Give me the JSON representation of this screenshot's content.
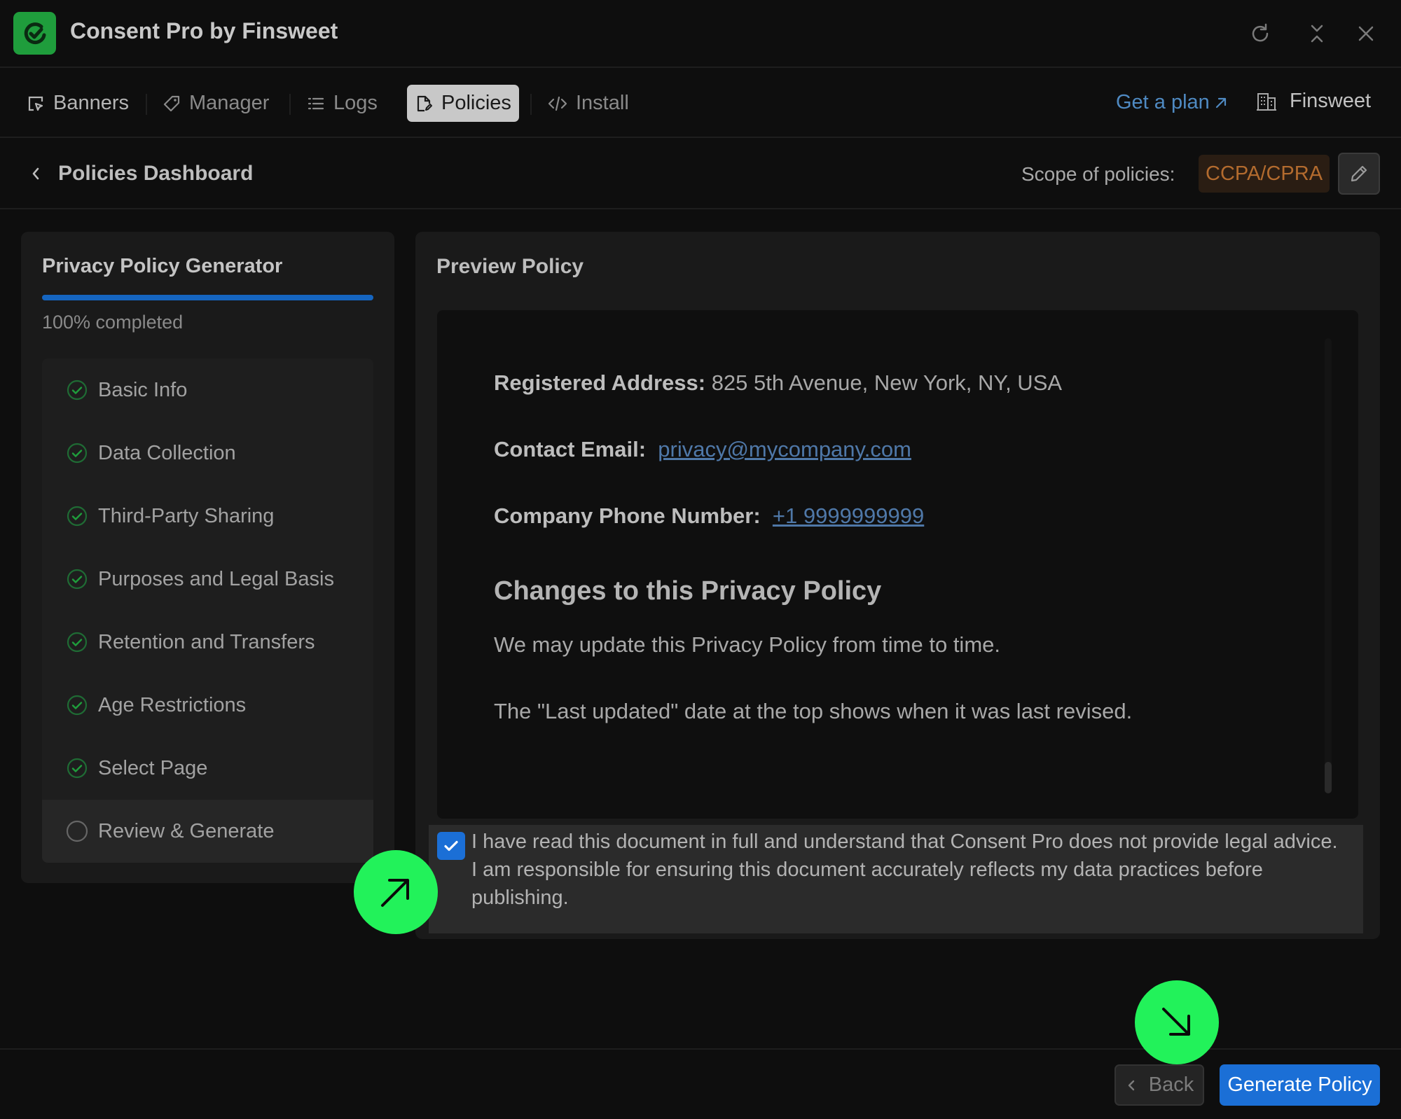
{
  "window": {
    "title": "Consent Pro by Finsweet"
  },
  "nav": {
    "items": [
      {
        "label": "Banners"
      },
      {
        "label": "Manager"
      },
      {
        "label": "Logs"
      },
      {
        "label": "Policies"
      },
      {
        "label": "Install"
      }
    ],
    "active": "Policies",
    "get_plan": "Get a plan",
    "workspace": "Finsweet"
  },
  "subheader": {
    "title": "Policies Dashboard",
    "scope_label": "Scope of policies:",
    "scope_value": "CCPA/CPRA"
  },
  "generator": {
    "title": "Privacy Policy Generator",
    "progress": 1.0,
    "progress_text": "100% completed",
    "steps": [
      {
        "label": "Basic Info",
        "done": true
      },
      {
        "label": "Data Collection",
        "done": true
      },
      {
        "label": "Third-Party Sharing",
        "done": true
      },
      {
        "label": "Purposes and Legal Basis",
        "done": true
      },
      {
        "label": "Retention and Transfers",
        "done": true
      },
      {
        "label": "Age Restrictions",
        "done": true
      },
      {
        "label": "Select Page",
        "done": true
      },
      {
        "label": "Review & Generate",
        "done": false
      }
    ]
  },
  "preview": {
    "title": "Preview Policy",
    "address_label": "Registered Address:",
    "address_value": "825 5th Avenue, New York, NY, USA",
    "email_label": "Contact Email:",
    "email_value": "privacy@mycompany.com",
    "phone_label": "Company Phone Number:",
    "phone_value": "+1 9999999999",
    "section_heading": "Changes to this Privacy Policy",
    "para1": "We may update this Privacy Policy from time to time.",
    "para2": "The \"Last updated\" date at the top shows when it was last revised."
  },
  "consent": {
    "checked": true,
    "text": "I have read this document in full and understand that Consent Pro does not provide legal advice. I am responsible for ensuring this document accurately reflects my data practices before publishing."
  },
  "footer": {
    "back_label": "Back",
    "generate_label": "Generate Policy"
  },
  "colors": {
    "accent_blue": "#1b6fd6",
    "progress_blue": "#1565c0",
    "check_green": "#1f9d3c",
    "marker_green": "#22f25a",
    "scope_orange": "#b36b2e"
  }
}
